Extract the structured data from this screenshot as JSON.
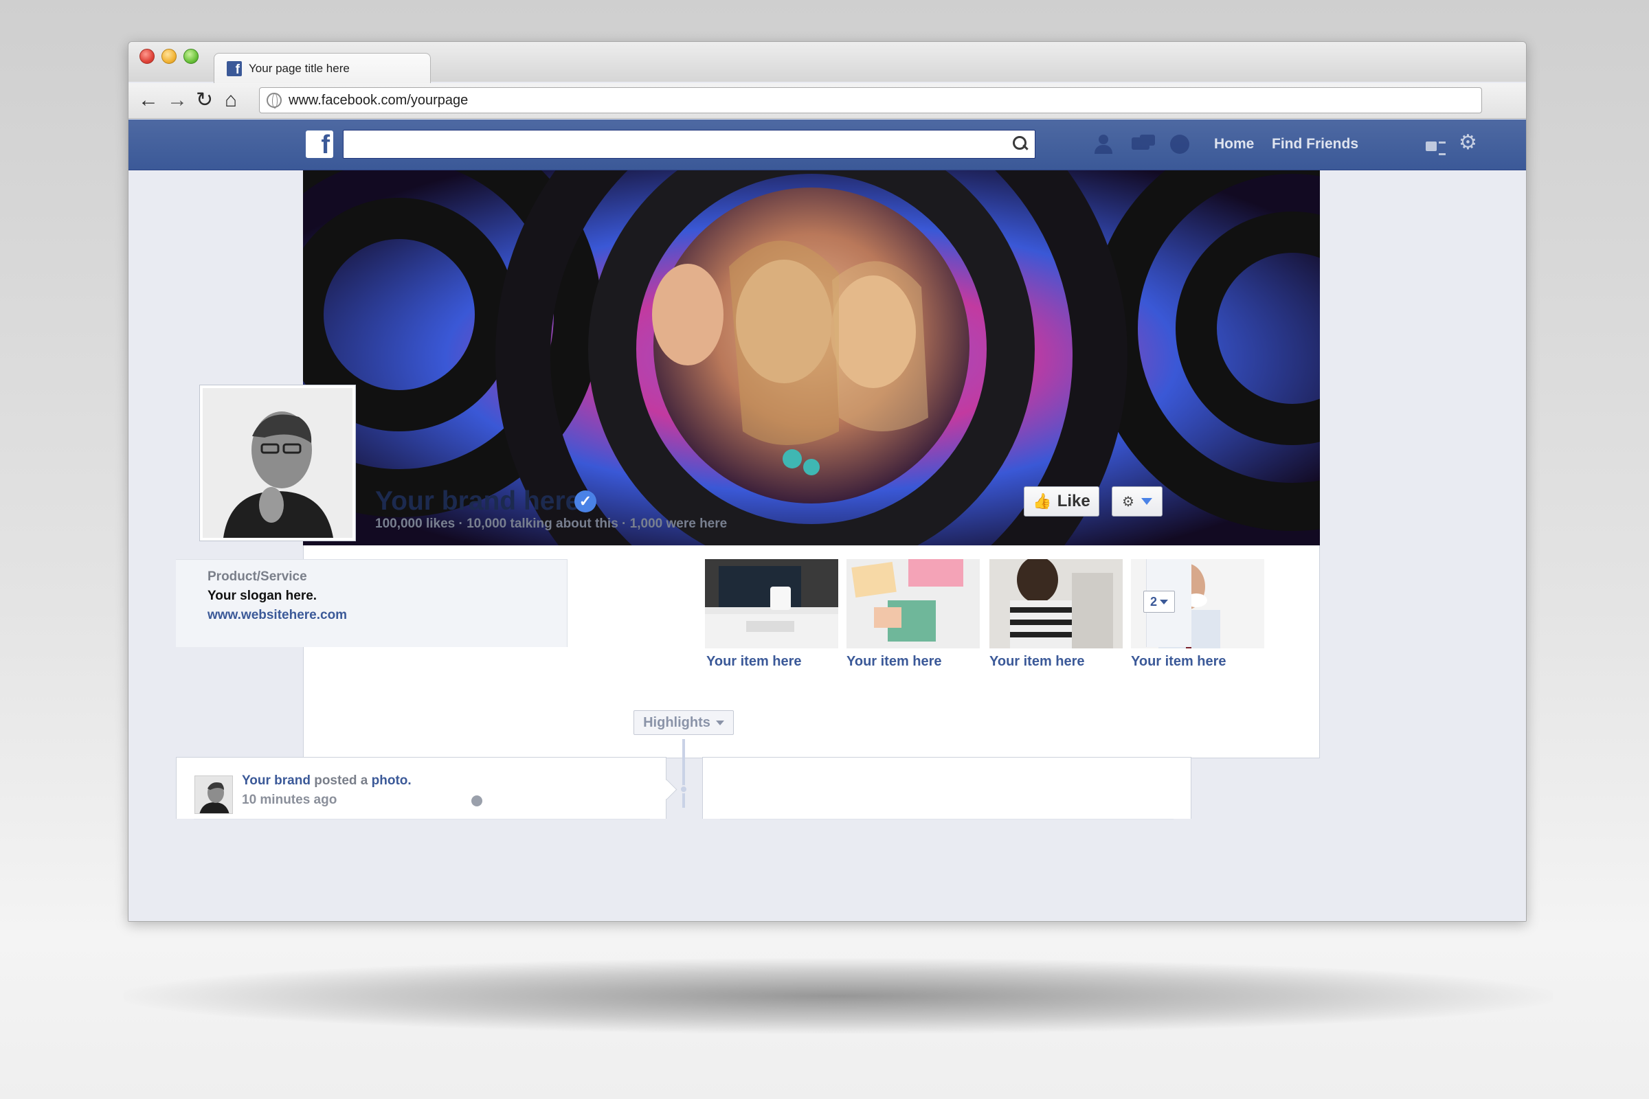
{
  "browser": {
    "tab_title": "Your page title here",
    "url": "www.facebook.com/yourpage"
  },
  "fb_nav": {
    "logo_letter": "f",
    "search_placeholder": "",
    "home": "Home",
    "find_friends": "Find Friends"
  },
  "profile": {
    "brand_name": "Your brand here",
    "verified_mark": "✓",
    "stats": "100,000 likes · 10,000 talking about this · 1,000 were here",
    "like_button": "Like"
  },
  "about": {
    "category": "Product/Service",
    "slogan": "Your slogan here.",
    "website": "www.websitehere.com"
  },
  "apps": [
    {
      "label": "Your item here"
    },
    {
      "label": "Your item here"
    },
    {
      "label": "Your item here"
    },
    {
      "label": "Your item here"
    }
  ],
  "apps_more_count": "2",
  "timeline": {
    "highlights": "Highlights"
  },
  "post": {
    "author": "Your brand",
    "action": " posted a ",
    "object": "photo.",
    "time": "10 minutes ago"
  },
  "icons": {
    "back": "arrow-left-icon",
    "forward": "arrow-right-icon",
    "reload": "reload-icon",
    "home": "home-icon",
    "search": "search-icon",
    "friends": "friend-requests-icon",
    "messages": "messages-icon",
    "notifications": "notifications-icon",
    "privacy": "privacy-shortcuts-icon",
    "settings": "gear-icon"
  },
  "colors": {
    "facebook_blue": "#3b5998",
    "verified_blue": "#4a82e6"
  }
}
